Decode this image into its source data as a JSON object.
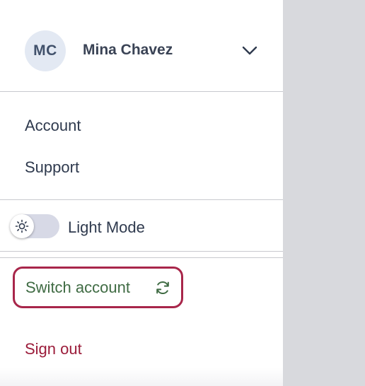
{
  "user": {
    "initials": "MC",
    "name": "Mina Chavez",
    "chevron_icon": "chevron-down-icon"
  },
  "menu": {
    "items": [
      {
        "label": "Account"
      },
      {
        "label": "Support"
      }
    ]
  },
  "theme": {
    "label": "Light Mode",
    "toggle_icon": "sun-icon",
    "dark_mode_enabled": false
  },
  "switch_account": {
    "label": "Switch account",
    "icon": "refresh-icon"
  },
  "sign_out": {
    "label": "Sign out"
  },
  "colors": {
    "panel_bg": "#ffffff",
    "backdrop": "#d8d9dd",
    "switch_border": "#a8264a",
    "switch_text": "#3f6b43",
    "signout_text": "#9b1c3a",
    "avatar_bg": "#e3e9f3"
  }
}
